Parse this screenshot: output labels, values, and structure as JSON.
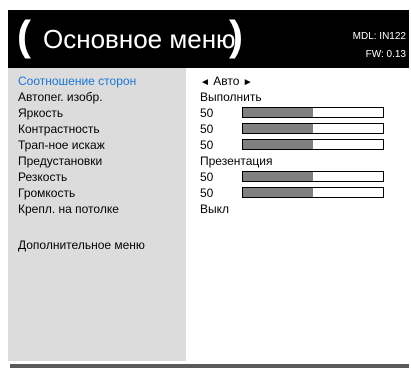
{
  "header": {
    "paren_left": "(",
    "title": "Основное меню",
    "paren_right": ")",
    "model": "MDL: IN122",
    "firmware": "FW: 0.13"
  },
  "menu": [
    {
      "label": "Соотношение сторон",
      "value": "Авто",
      "arrow_left": "◄",
      "arrow_right": "►",
      "active": true
    },
    {
      "label": "Автопег. изобр.",
      "value": "Выполнить"
    },
    {
      "label": "Яркость",
      "value": "50",
      "level": 0.5
    },
    {
      "label": "Контрастность",
      "value": "50",
      "level": 0.5
    },
    {
      "label": "Трап-ное искаж",
      "value": "50",
      "level": 0.5
    },
    {
      "label": "Предустановки",
      "value": "Презентация"
    },
    {
      "label": "Резкость",
      "value": "50",
      "level": 0.5
    },
    {
      "label": "Громкость",
      "value": "50",
      "level": 0.5
    },
    {
      "label": "Крепл. на потолке",
      "value": "Выкл"
    }
  ],
  "extra": {
    "label": "Дополнительное меню"
  },
  "colors": {
    "highlight": "#1a75d6",
    "bar_fill": "#808080",
    "left_panel": "#dcdcdc"
  }
}
